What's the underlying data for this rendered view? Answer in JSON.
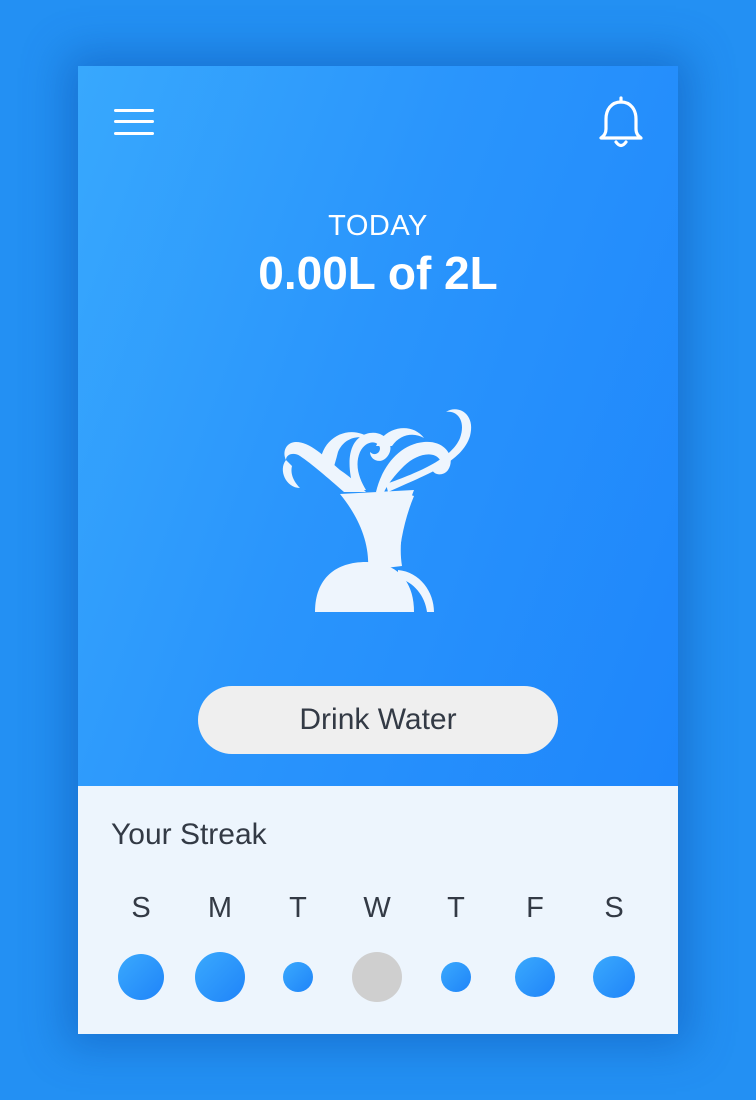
{
  "header": {
    "menu_icon": "hamburger-menu-icon",
    "notification_icon": "bell-icon"
  },
  "summary": {
    "label": "TODAY",
    "amount": "0.00L of 2L"
  },
  "illustration": {
    "icon": "water-fountain-icon"
  },
  "actions": {
    "drink_label": "Drink Water"
  },
  "streak": {
    "title": "Your Streak",
    "days": [
      {
        "letter": "S",
        "status": "done"
      },
      {
        "letter": "M",
        "status": "done"
      },
      {
        "letter": "T",
        "status": "done"
      },
      {
        "letter": "W",
        "status": "missed"
      },
      {
        "letter": "T",
        "status": "done"
      },
      {
        "letter": "F",
        "status": "done"
      },
      {
        "letter": "S",
        "status": "done"
      }
    ]
  },
  "colors": {
    "background": "#2390f3",
    "hero_light": "#38a8fd",
    "hero_dark": "#1e86fb",
    "panel": "#edf5fd",
    "button": "#efefef",
    "text": "#333a45",
    "missed": "#cfcfcf"
  }
}
